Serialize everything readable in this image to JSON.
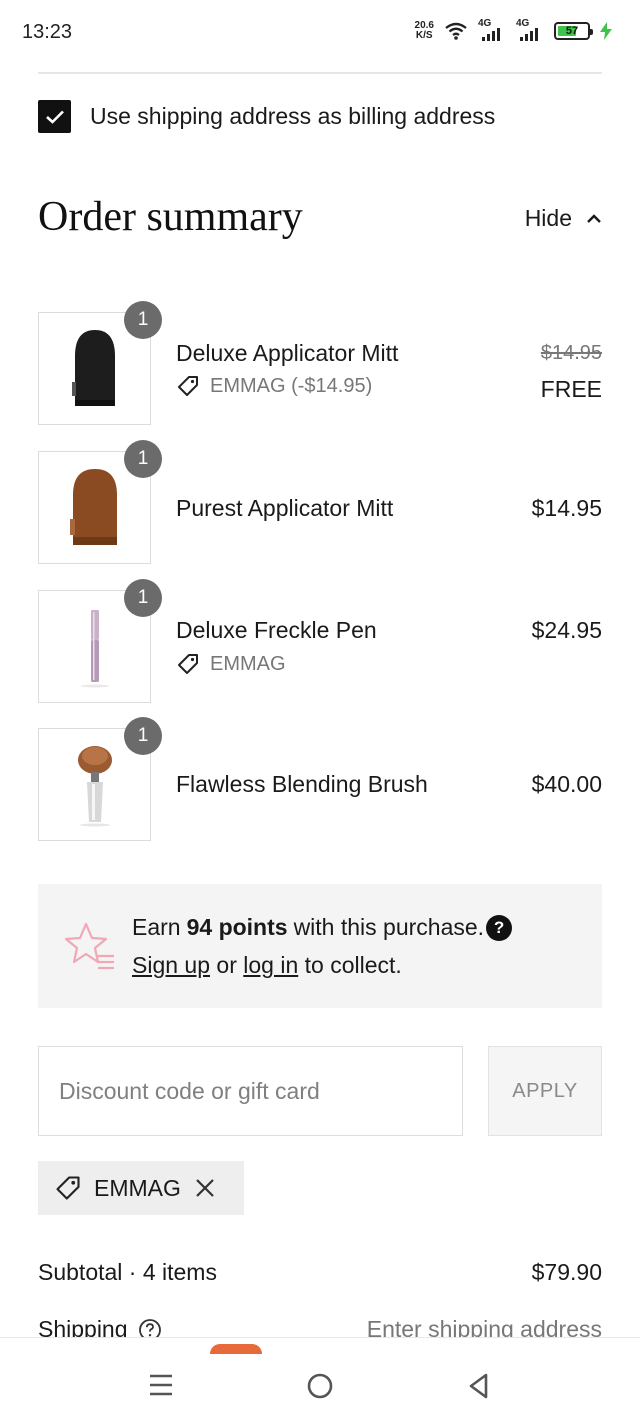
{
  "status_bar": {
    "time": "13:23",
    "net_speed_value": "20.6",
    "net_speed_unit": "K/S",
    "signal_1": "4G",
    "signal_2": "4G",
    "battery_level": "57",
    "battery_color": "#3ec44a"
  },
  "billing": {
    "label": "Use shipping address as billing address",
    "checked": true
  },
  "summary": {
    "title": "Order summary",
    "toggle_label": "Hide"
  },
  "items": [
    {
      "quantity": "1",
      "name": "Deluxe Applicator Mitt",
      "discount_label": "EMMAG (-$14.95)",
      "original_price": "$14.95",
      "price": "FREE",
      "thumb_icon": "black-mitt"
    },
    {
      "quantity": "1",
      "name": "Purest Applicator Mitt",
      "price": "$14.95",
      "thumb_icon": "brown-mitt"
    },
    {
      "quantity": "1",
      "name": "Deluxe Freckle Pen",
      "discount_label": "EMMAG",
      "price": "$24.95",
      "thumb_icon": "pen"
    },
    {
      "quantity": "1",
      "name": "Flawless Blending Brush",
      "price": "$40.00",
      "thumb_icon": "brush"
    }
  ],
  "rewards": {
    "earn_prefix": "Earn",
    "points": "94 points",
    "earn_suffix": "with this purchase.",
    "help_glyph": "?",
    "sign_up": "Sign up",
    "or": "or",
    "log_in": "log in",
    "collect": "to collect.",
    "star_color": "#f2a7b4"
  },
  "discount": {
    "placeholder": "Discount code or gift card",
    "value": "",
    "apply_label": "APPLY",
    "applied_code": "EMMAG"
  },
  "totals": {
    "subtotal_label": "Subtotal · 4 items",
    "subtotal_value": "$79.90",
    "shipping_label": "Shipping",
    "shipping_value": "Enter shipping address"
  }
}
